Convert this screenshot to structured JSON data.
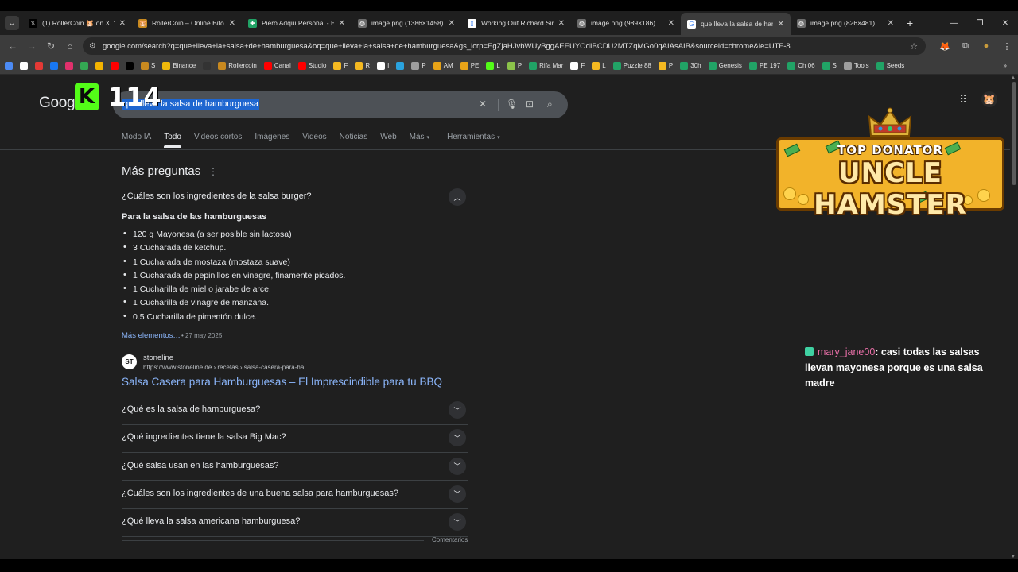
{
  "browser": {
    "tabs": [
      {
        "title": "(1) RollerCoin 🐹 on X: \"🎁",
        "fav_color": "#000000",
        "fav_glyph": "𝕏",
        "active": false
      },
      {
        "title": "RollerCoin – Online Bitcoin",
        "fav_color": "#c8891f",
        "fav_glyph": "🐹",
        "active": false
      },
      {
        "title": "Piero Adqui Personal - Ho",
        "fav_color": "#21a366",
        "fav_glyph": "✚",
        "active": false
      },
      {
        "title": "image.png (1386×1458)",
        "fav_color": "#6b6b6b",
        "fav_glyph": "◍",
        "active": false
      },
      {
        "title": "Working Out Richard Sim",
        "fav_color": "#ffffff",
        "fav_glyph": "▯",
        "active": false
      },
      {
        "title": "image.png (989×186)",
        "fav_color": "#6b6b6b",
        "fav_glyph": "◍",
        "active": false
      },
      {
        "title": "que lleva la salsa de hambu",
        "fav_color": "#ffffff",
        "fav_glyph": "G",
        "active": true
      },
      {
        "title": "image.png (826×481)",
        "fav_color": "#6b6b6b",
        "fav_glyph": "◍",
        "active": false
      }
    ],
    "url": "google.com/search?q=que+lleva+la+salsa+de+hamburguesa&oq=que+lleva+la+salsa+de+hamburguesa&gs_lcrp=EgZjaHJvbWUyBggAEEUYOdIBCDU2MTZqMGo0qAIAsAIB&sourceid=chrome&ie=UTF-8",
    "bookmarks": [
      {
        "label": "",
        "color": "#4c8bf5"
      },
      {
        "label": "",
        "color": "#ffffff"
      },
      {
        "label": "",
        "color": "#e53935"
      },
      {
        "label": "",
        "color": "#1877f2"
      },
      {
        "label": "",
        "color": "#e1306c"
      },
      {
        "label": "",
        "color": "#34a853"
      },
      {
        "label": "",
        "color": "#f4b400"
      },
      {
        "label": "",
        "color": "#ff0000"
      },
      {
        "label": "",
        "color": "#000000"
      },
      {
        "label": "S",
        "color": "#c8891f"
      },
      {
        "label": "Binance",
        "color": "#f0b90b"
      },
      {
        "label": "",
        "color": "#333333"
      },
      {
        "label": "Rollercoin",
        "color": "#c8891f"
      },
      {
        "label": "Canal",
        "color": "#ff0000"
      },
      {
        "label": "Studio",
        "color": "#ff0000"
      },
      {
        "label": "F",
        "color": "#f5b921"
      },
      {
        "label": "R",
        "color": "#f5b921"
      },
      {
        "label": "I",
        "color": "#ffffff"
      },
      {
        "label": "",
        "color": "#2aa3df"
      },
      {
        "label": "P",
        "color": "#9e9e9e"
      },
      {
        "label": "AM",
        "color": "#e8a317"
      },
      {
        "label": "PE",
        "color": "#e8a317"
      },
      {
        "label": "L",
        "color": "#53fc18"
      },
      {
        "label": "P",
        "color": "#8bc34a"
      },
      {
        "label": "Rifa Mar",
        "color": "#21a366"
      },
      {
        "label": "F",
        "color": "#ffffff"
      },
      {
        "label": "L",
        "color": "#f5b921"
      },
      {
        "label": "Puzzle 88",
        "color": "#21a366"
      },
      {
        "label": "P",
        "color": "#f5b921"
      },
      {
        "label": "30h",
        "color": "#21a366"
      },
      {
        "label": "Genesis",
        "color": "#21a366"
      },
      {
        "label": "PE 197",
        "color": "#21a366"
      },
      {
        "label": "Ch 06",
        "color": "#21a366"
      },
      {
        "label": "S",
        "color": "#21a366"
      },
      {
        "label": "Tools",
        "color": "#9e9e9e"
      },
      {
        "label": "Seeds",
        "color": "#21a366"
      }
    ]
  },
  "google": {
    "logo": "Google",
    "query": "que lleva la salsa de hamburguesa",
    "tabs": [
      "Modo IA",
      "Todo",
      "Videos cortos",
      "Imágenes",
      "Videos",
      "Noticias",
      "Web",
      "Más",
      "Herramientas"
    ],
    "active_tab": "Todo"
  },
  "overlay": {
    "kick_letter": "K",
    "count": "114"
  },
  "paa": {
    "title": "Más preguntas",
    "open_question": "¿Cuáles son los ingredientes de la salsa burger?",
    "answer_heading": "Para la salsa de las hamburguesas",
    "ingredients": [
      "120 g Mayonesa (a ser posible sin lactosa)",
      "3 Cucharada de ketchup.",
      "1 Cucharada de mostaza (mostaza suave)",
      "1 Cucharada de pepinillos en vinagre, finamente picados.",
      "1 Cucharilla de miel o jarabe de arce.",
      "1 Cucharilla de vinagre de manzana.",
      "0.5 Cucharilla de pimentón dulce."
    ],
    "more_link": "Más elementos…",
    "date": "• 27 may 2025",
    "source": {
      "icon_text": "ST",
      "name": "stoneline",
      "url": "https://www.stoneline.de › recetas › salsa-casera-para-ha...",
      "link": "Salsa Casera para Hamburguesas – El Imprescindible para tu BBQ"
    },
    "questions": [
      "¿Qué es la salsa de hamburguesa?",
      "¿Qué ingredientes tiene la salsa Big Mac?",
      "¿Qué salsa usan en las hamburguesas?",
      "¿Cuáles son los ingredientes de una buena salsa para hamburguesas?",
      "¿Qué lleva la salsa americana hamburguesa?"
    ],
    "comments_link": "Comentarios"
  },
  "donator": {
    "top": "TOP DONATOR",
    "name": "UNCLE HAMSTER"
  },
  "chat": {
    "user": "mary_jane00",
    "message": ": casi todas las salsas llevan mayonesa porque es una salsa madre"
  }
}
